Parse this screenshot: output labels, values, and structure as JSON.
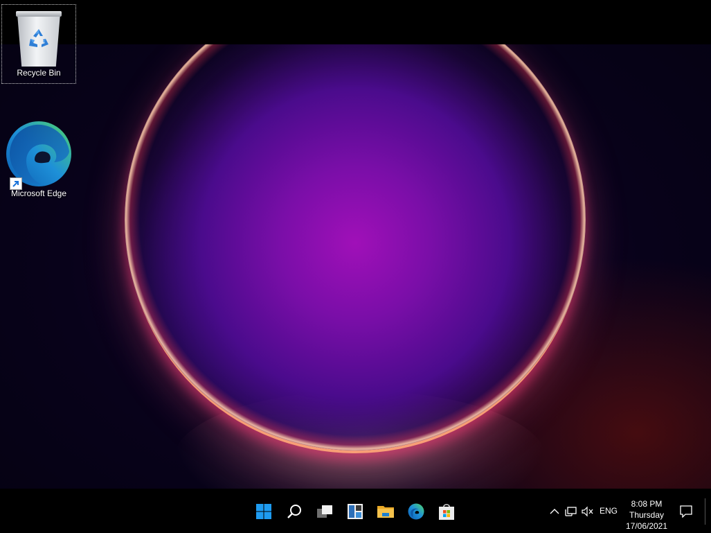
{
  "desktop": {
    "icons": [
      {
        "label": "Recycle Bin",
        "icon": "recycle-bin-icon",
        "selected": true
      },
      {
        "label": "Microsoft Edge",
        "icon": "edge-icon",
        "shortcut": true
      }
    ]
  },
  "taskbar": {
    "buttons": [
      {
        "name": "start-button",
        "icon": "windows-logo-icon"
      },
      {
        "name": "search-button",
        "icon": "search-icon"
      },
      {
        "name": "task-view-button",
        "icon": "task-view-icon"
      },
      {
        "name": "widgets-button",
        "icon": "widgets-icon"
      },
      {
        "name": "file-explorer-button",
        "icon": "folder-icon"
      },
      {
        "name": "edge-taskbar-button",
        "icon": "edge-icon"
      },
      {
        "name": "store-button",
        "icon": "store-icon"
      }
    ],
    "tray": {
      "language": "ENG",
      "icons": [
        "chevron-up-icon",
        "network-icon",
        "volume-muted-icon"
      ]
    },
    "clock": {
      "time": "8:08 PM",
      "day": "Thursday",
      "date": "17/06/2021"
    },
    "notification_icon": "notification-icon"
  },
  "colors": {
    "accent": "#0078d4",
    "taskbar": "#000000",
    "folder": "#f5c24c"
  }
}
